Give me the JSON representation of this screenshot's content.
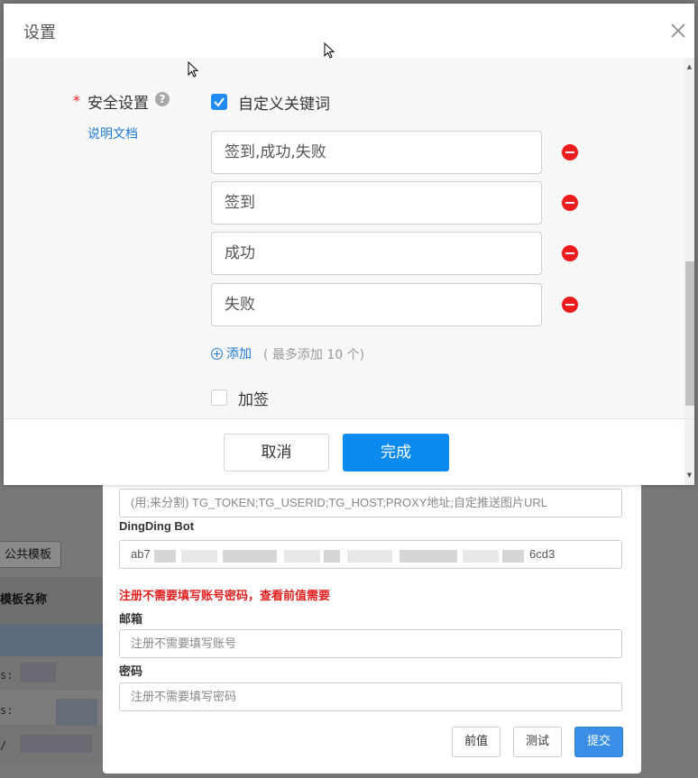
{
  "dialog": {
    "title": "设置",
    "field_label": "安全设置",
    "required_mark": "*",
    "help_glyph": "?",
    "doc_link": "说明文档",
    "custom_keyword": {
      "label": "自定义关键词",
      "checked": true
    },
    "keywords": [
      "签到,成功,失败",
      "签到",
      "成功",
      "失败"
    ],
    "add_label": "添加",
    "add_hint": "( 最多添加 10 个)",
    "sign": {
      "label": "加签",
      "checked": false
    },
    "cancel_label": "取消",
    "done_label": "完成"
  },
  "form": {
    "tg_placeholder": "(用;来分割) TG_TOKEN;TG_USERID;TG_HOST;PROXY地址;自定推送图片URL",
    "dingding_label": "DingDing Bot",
    "dingding_prefix": "ab7",
    "dingding_suffix": "6cd3",
    "warning": "注册不需要填写账号密码，查看前值需要",
    "email_label": "邮箱",
    "email_placeholder": "注册不需要填写账号",
    "password_label": "密码",
    "password_placeholder": "注册不需要填写密码",
    "prev_label": "前值",
    "test_label": "测试",
    "submit_label": "提交"
  },
  "background": {
    "public_template_label": "公共模板",
    "template_name_header": "模板名称",
    "row_fragments": [
      "s:",
      "s:",
      "/"
    ]
  },
  "colors": {
    "primary": "#0b8af0",
    "link": "#1f7bd6",
    "danger": "#ee1c1c",
    "warning_text": "#e02020"
  }
}
